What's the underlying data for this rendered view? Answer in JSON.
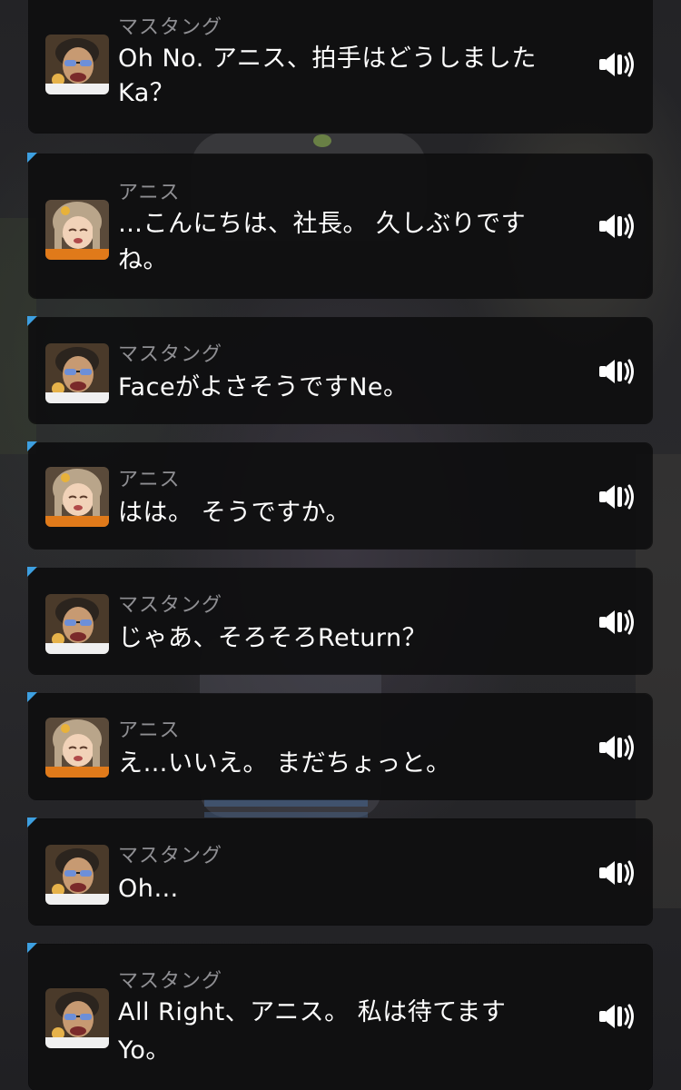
{
  "messages": [
    {
      "speaker": "マスタング",
      "text_lines": [
        "Oh No. アニス、拍手はどうしました",
        "Ka？"
      ]
    },
    {
      "speaker": "アニス",
      "text_lines": [
        "…こんにちは、社長。 久しぶりです",
        "ね。"
      ]
    },
    {
      "speaker": "マスタング",
      "text_lines": [
        "FaceがよさそうですNe。"
      ]
    },
    {
      "speaker": "アニス",
      "text_lines": [
        "はは。 そうですか。"
      ]
    },
    {
      "speaker": "マスタング",
      "text_lines": [
        "じゃあ、そろそろReturn？"
      ]
    },
    {
      "speaker": "アニス",
      "text_lines": [
        "え…いいえ。 まだちょっと。"
      ]
    },
    {
      "speaker": "マスタング",
      "text_lines": [
        "Oh…"
      ]
    },
    {
      "speaker": "マスタング",
      "text_lines": [
        "All Right、アニス。 私は待てます",
        "Yo。"
      ]
    }
  ],
  "icons": {
    "play_voice": "speaker-icon",
    "avatar_mustang": "mustang-avatar",
    "avatar_anis": "anis-avatar"
  },
  "colors": {
    "bubble_bg": "#101011",
    "accent_corner": "#3d9fe0",
    "name_text": "#8f8f93",
    "body_text": "#ffffff"
  }
}
